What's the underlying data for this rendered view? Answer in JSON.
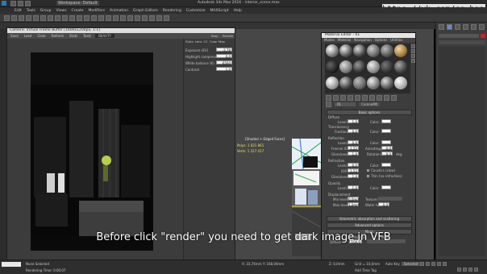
{
  "window": {
    "title": "Autodesk 3ds Max 2016 - interior_scene.max",
    "workspace": "Workspace: Default",
    "watermark": "https://vk.com/cg_bandit"
  },
  "menu": [
    "Edit",
    "Tools",
    "Group",
    "Views",
    "Create",
    "Modifiers",
    "Animation",
    "Graph Editors",
    "Rendering",
    "Customize",
    "MAXScript",
    "Help"
  ],
  "vfb": {
    "title": "Camera: Virtual Frame Buffer [1600x1200px, 1:1]",
    "tools": [
      "Save",
      "Load",
      "Clear",
      "Refresh",
      "Stats",
      "Tools",
      "BEAUTY"
    ],
    "tabs": [
      "Stats",
      "Lens",
      "CC",
      "Color Map"
    ],
    "tab_right": [
      "Stop",
      "Render"
    ],
    "params": [
      {
        "label": "Exposure (EV)",
        "value": "-3,78"
      },
      {
        "label": "Highlight compression",
        "value": "0,0"
      },
      {
        "label": "White balance (K)",
        "value": "6500"
      },
      {
        "label": "Contrast",
        "value": "1,0"
      }
    ]
  },
  "viewport": {
    "label": "[Shaded + Edged Faces]",
    "stats": [
      "Polys: 1 021 861",
      "Verts: 1 227 417"
    ]
  },
  "material_editor": {
    "title": "Material Editor - 01",
    "menu": [
      "Modes",
      "Material",
      "Navigation",
      "Options",
      "Utilities"
    ],
    "material_name": "01",
    "material_type": "CoronaMtl",
    "sections": {
      "basic": "Basic options",
      "volumetric": "Volumetric absorption and scattering",
      "advanced": "Advanced options",
      "maps": "Maps"
    },
    "diffuse": {
      "header": "Diffuse",
      "level_label": "Level:",
      "level": "1,0",
      "color_label": "Color:",
      "translucency": "Translucency",
      "fraction_label": "Fraction:",
      "fraction": "0,0"
    },
    "reflection": {
      "header": "Reflection",
      "level_label": "Level:",
      "level": "0,0",
      "color_label": "Color:",
      "fresnel_label": "Fresnel IOR:",
      "fresnel": "1,52",
      "aniso_label": "Anisotropy:",
      "aniso": "0,0",
      "gloss_label": "Glossiness:",
      "gloss": "1,0",
      "rotation_label": "Rotation:",
      "rotation": "0,0",
      "deg": "deg"
    },
    "refraction": {
      "header": "Refraction",
      "level_label": "Level:",
      "level": "0,0",
      "color_label": "Color:",
      "ior_label": "IOR:",
      "ior": "1,52",
      "caustics": "Caustics (slow)",
      "gloss_label": "Glossiness:",
      "gloss": "1,0",
      "thin": "Thin (no refraction)"
    },
    "opacity": {
      "header": "Opacity",
      "level_label": "Level:",
      "level": "1,0",
      "color_label": "Color:"
    },
    "displacement": {
      "header": "Displacement",
      "min_label": "Min level:",
      "min": "0,0mm",
      "texture_label": "Texture:",
      "max_label": "Max level:",
      "max": "1,0mm",
      "water_label": "Water lv:",
      "water": "0,0"
    },
    "maps_cols": [
      "Amount",
      "Map"
    ],
    "maps_first": "Diffuse",
    "maps_amount": "100,0"
  },
  "subtitle": "Before click \"render\" you need to get dark image in VFB",
  "status": {
    "selection": "None Selected",
    "render_time": "Rendering Time: 0:00:07",
    "z": "Z: 0,0mm",
    "grid": "Grid = 10,0mm",
    "autokey": "Auto Key",
    "selected": "Selected",
    "add_time_tag": "Add Time Tag",
    "coords": "X: 33,74mm   Y: 168,04mm"
  },
  "colors": {
    "accent": "#3b6ea5",
    "swatch_white": "#ffffff",
    "swatch_black": "#000000"
  }
}
